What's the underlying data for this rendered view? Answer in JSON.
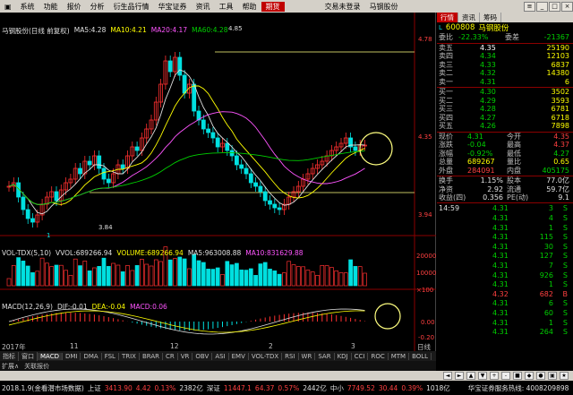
{
  "menu": {
    "items": [
      "系统",
      "功能",
      "报价",
      "分析",
      "衍生品行情",
      "华宝证券",
      "资讯",
      "工具",
      "帮助"
    ],
    "highlight": "期货",
    "login": "交易未登录",
    "stock": "马钢股份"
  },
  "kline": {
    "title": "马钢股份(日线 前复权)",
    "ma5_label": "MA5:",
    "ma5": "4.28",
    "ma10_label": "MA10:",
    "ma10": "4.21",
    "ma20_label": "MA20:",
    "ma20": "4.17",
    "ma60_label": "MA60:",
    "ma60": "4.28",
    "high_label": "4.85",
    "low_label": "3.84",
    "axis": [
      "4.78",
      "4.35",
      "3.94"
    ],
    "marker": "1"
  },
  "vol": {
    "title": "VOL-TDX(5,10)",
    "vvol_label": "VVOL:",
    "vvol": "689266.94",
    "volume_label": "VOLUME:",
    "volume": "689266.94",
    "ma5_label": "MA5:",
    "ma5": "963008.88",
    "ma10_label": "MA10:",
    "ma10": "831629.88",
    "axis": [
      "20000",
      "10000",
      "×100"
    ]
  },
  "macd": {
    "title": "MACD(12,26,9)",
    "dif_label": "DIF:",
    "dif": "-0.01",
    "dea_label": "DEA:",
    "dea": "-0.04",
    "macd_label": "MACD:",
    "macd": "0.06",
    "axis": [
      "0.00",
      "-0.20"
    ]
  },
  "xaxis": {
    "year": "2017年",
    "labels": [
      "11",
      "12",
      "2",
      "3",
      "日线"
    ]
  },
  "tabs": [
    "指标",
    "窗口",
    "MACD",
    "DMI",
    "DMA",
    "FSL",
    "TRIX",
    "BRAR",
    "CR",
    "VR",
    "OBV",
    "ASI",
    "EMV",
    "VOL-TDX",
    "RSI",
    "WR",
    "SAR",
    "KDJ",
    "CCI",
    "ROC",
    "MTM",
    "BOLL"
  ],
  "subbar": [
    "扩展∧",
    "关联报价"
  ],
  "status": {
    "date": "2018.1.9(金看潜市场数据)",
    "sh_label": "上证",
    "sh_val": "3413.90",
    "sh_chg": "4.42",
    "sh_pct": "0.13%",
    "sh_amt": "2382亿",
    "sz_label": "深证",
    "sz_val": "11447.1",
    "sz_chg": "64.37",
    "sz_pct": "0.57%",
    "sz_amt": "2442亿",
    "zx_label": "中小",
    "zx_val": "7749.52",
    "zx_chg": "30.44",
    "zx_pct": "0.39%",
    "zx_amt": "1018亿",
    "hotline": "华宝证券服务热线: 4008209898"
  },
  "rpanel": {
    "tabs": [
      "行情",
      "资讯",
      "筹码"
    ],
    "code": "600808",
    "name": "马钢股份",
    "webi_label": "委比",
    "webi_val": "-22.33%",
    "weicha_label": "委差",
    "weicha_val": "-21367",
    "asks": [
      {
        "label": "卖五",
        "price": "4.35",
        "vol": "25190"
      },
      {
        "label": "卖四",
        "price": "4.34",
        "vol": "12103"
      },
      {
        "label": "卖三",
        "price": "4.33",
        "vol": "6837"
      },
      {
        "label": "卖二",
        "price": "4.32",
        "vol": "14380"
      },
      {
        "label": "卖一",
        "price": "4.31",
        "vol": "6"
      }
    ],
    "bids": [
      {
        "label": "买一",
        "price": "4.30",
        "vol": "3502"
      },
      {
        "label": "买二",
        "price": "4.29",
        "vol": "3593"
      },
      {
        "label": "买三",
        "price": "4.28",
        "vol": "6781"
      },
      {
        "label": "买四",
        "price": "4.27",
        "vol": "6718"
      },
      {
        "label": "买五",
        "price": "4.26",
        "vol": "7898"
      }
    ],
    "stats": [
      {
        "l1": "现价",
        "v1": "4.31",
        "l2": "今开",
        "v2": "4.35"
      },
      {
        "l1": "涨跌",
        "v1": "-0.04",
        "l2": "最高",
        "v2": "4.37"
      },
      {
        "l1": "涨幅",
        "v1": "-0.92%",
        "l2": "最低",
        "v2": "4.27"
      },
      {
        "l1": "总量",
        "v1": "689267",
        "l2": "量比",
        "v2": "0.65"
      },
      {
        "l1": "外盘",
        "v1": "284091",
        "l2": "内盘",
        "v2": "405175"
      }
    ],
    "stats2": [
      {
        "l1": "换手",
        "v1": "1.15%",
        "l2": "股本",
        "v2": "77.0亿"
      },
      {
        "l1": "净资",
        "v1": "2.92",
        "l2": "流通",
        "v2": "59.7亿"
      },
      {
        "l1": "收益(四)",
        "v1": "0.356",
        "l2": "PE(动)",
        "v2": "9.1"
      }
    ],
    "ticks": [
      {
        "t": "14:59",
        "p": "4.31",
        "v": "3",
        "s": "S"
      },
      {
        "t": "",
        "p": "4.31",
        "v": "4",
        "s": "S"
      },
      {
        "t": "",
        "p": "4.31",
        "v": "1",
        "s": "S"
      },
      {
        "t": "",
        "p": "4.31",
        "v": "115",
        "s": "S"
      },
      {
        "t": "",
        "p": "4.31",
        "v": "30",
        "s": "S"
      },
      {
        "t": "",
        "p": "4.31",
        "v": "127",
        "s": "S"
      },
      {
        "t": "",
        "p": "4.31",
        "v": "7",
        "s": "S"
      },
      {
        "t": "",
        "p": "4.31",
        "v": "926",
        "s": "S"
      },
      {
        "t": "",
        "p": "4.31",
        "v": "1",
        "s": "S"
      },
      {
        "t": "",
        "p": "4.32",
        "v": "682",
        "s": "B"
      },
      {
        "t": "",
        "p": "4.31",
        "v": "6",
        "s": "S"
      },
      {
        "t": "",
        "p": "4.31",
        "v": "60",
        "s": "S"
      },
      {
        "t": "",
        "p": "4.31",
        "v": "1",
        "s": "S"
      },
      {
        "t": "",
        "p": "4.31",
        "v": "264",
        "s": "S"
      }
    ]
  }
}
